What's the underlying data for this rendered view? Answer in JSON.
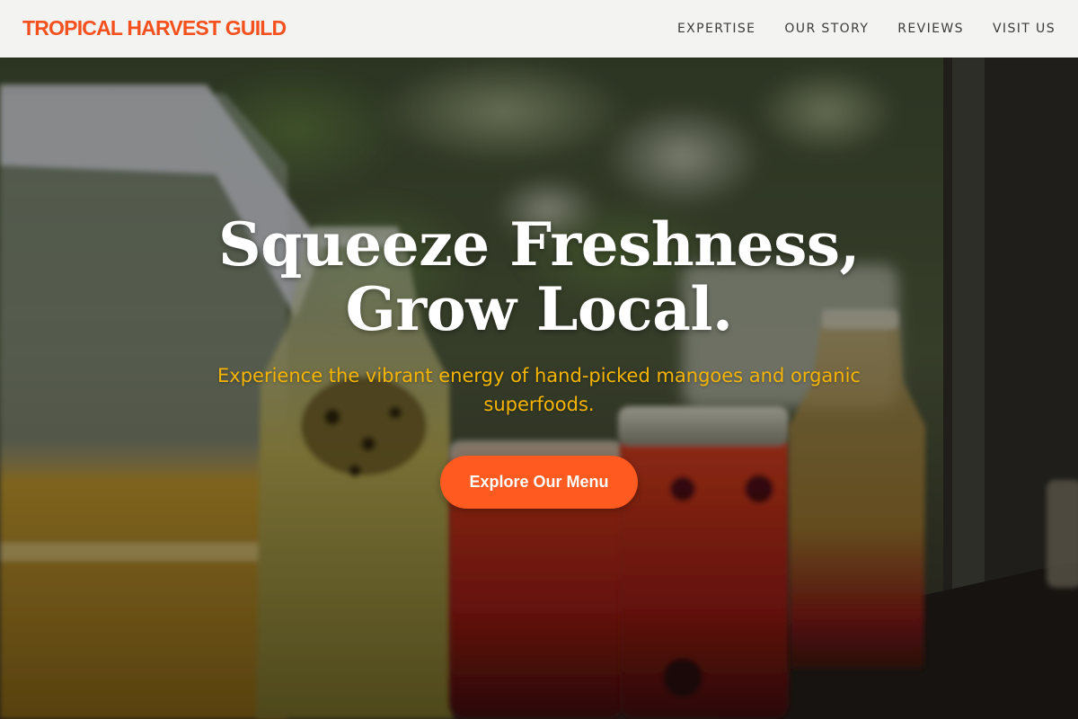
{
  "header": {
    "brand": "TROPICAL HARVEST GUILD",
    "nav": [
      "EXPERTISE",
      "OUR STORY",
      "REVIEWS",
      "VISIT US"
    ]
  },
  "hero": {
    "title": "Squeeze Freshness, Grow Local.",
    "subtitle": "Experience the vibrant energy of hand-picked mangoes and organic superfoods.",
    "cta_label": "Explore Our Menu"
  },
  "colors": {
    "brand": "#f4511e",
    "accent_yellow": "#f5b400",
    "cta": "#ff5a1f",
    "header_bg": "#f3f3f1"
  }
}
